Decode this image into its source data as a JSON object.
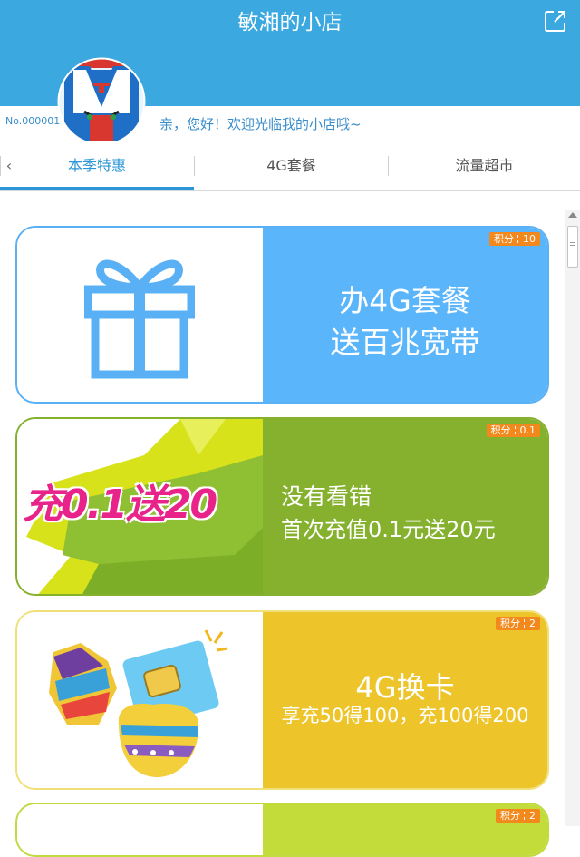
{
  "header": {
    "title": "敏湘的小店",
    "share_icon": "share-external-icon",
    "color": "#3ba8e0"
  },
  "profile": {
    "shop_no": "No.000001",
    "welcome": "亲，您好！欢迎光临我的小店哦~"
  },
  "tabs": {
    "back_icon": "chevron-left-icon",
    "items": [
      {
        "label": "本季特惠"
      },
      {
        "label": "4G套餐"
      },
      {
        "label": "流量超市"
      }
    ],
    "active": "本季特惠",
    "accent": "#2a95d7"
  },
  "cards": [
    {
      "line1": "办4G套餐",
      "line2": "送百兆宽带",
      "badge_label": "积分",
      "badge_value": "10",
      "icon": "gift-icon",
      "color": "#5ab5fb"
    },
    {
      "image_text": "充0.1送20",
      "line1": "没有看错",
      "line2": "首次充值0.1元送20元",
      "badge_label": "积分",
      "badge_value": "0.1",
      "color": "#85b12f"
    },
    {
      "line1": "4G换卡",
      "line2": "享充50得100，充100得200",
      "badge_label": "积分",
      "badge_value": "2",
      "icon": "sim-card-egg-icon",
      "color": "#edc52a"
    },
    {
      "badge_label": "积分",
      "badge_value": "2",
      "color": "#c3dc3a"
    }
  ]
}
